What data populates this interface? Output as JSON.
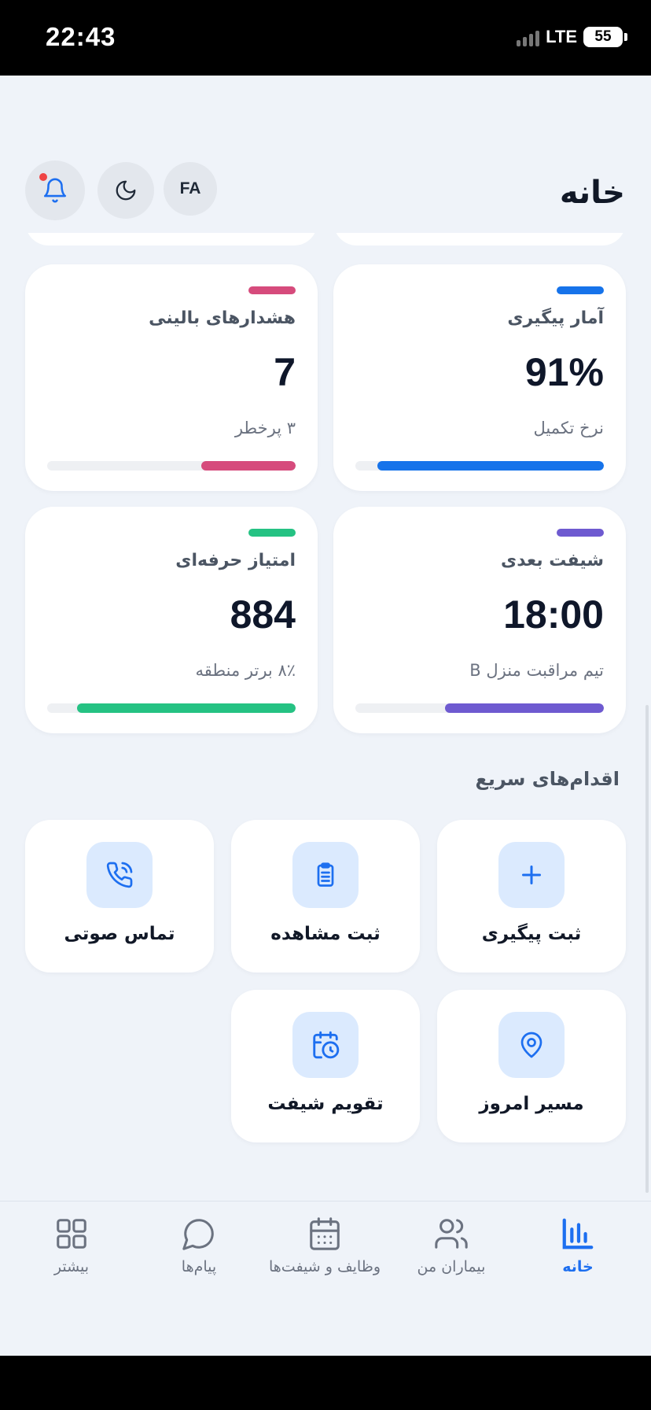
{
  "status_bar": {
    "time": "22:43",
    "network": "LTE",
    "battery": "55"
  },
  "header": {
    "title": "خانه",
    "lang_label": "FA"
  },
  "stats": [
    {
      "title": "آمار پیگیری",
      "value": "91%",
      "subtitle": "نرخ تکمیل",
      "color": "#1673ea",
      "progress": 0.91
    },
    {
      "title": "هشدارهای بالینی",
      "value": "7",
      "subtitle": "۳ پرخطر",
      "color": "#d64b7c",
      "progress": 0.38
    },
    {
      "title": "شیفت بعدی",
      "value": "18:00",
      "subtitle": "تیم مراقبت منزل B",
      "color": "#6e5ad0",
      "progress": 0.64
    },
    {
      "title": "امتیاز حرفه‌ای",
      "value": "884",
      "subtitle": "۸٪ برتر منطقه",
      "color": "#25c283",
      "progress": 0.88
    }
  ],
  "quick_actions_title": "اقدام‌های سریع",
  "quick_actions": [
    {
      "label": "ثبت پیگیری",
      "icon": "plus-icon"
    },
    {
      "label": "ثبت مشاهده",
      "icon": "clipboard-icon"
    },
    {
      "label": "تماس صوتی",
      "icon": "phone-call-icon"
    },
    {
      "label": "مسیر امروز",
      "icon": "map-pin-icon"
    },
    {
      "label": "تقویم شیفت",
      "icon": "calendar-clock-icon"
    }
  ],
  "nav": [
    {
      "label": "خانه",
      "icon": "bar-chart-icon",
      "active": true
    },
    {
      "label": "بیماران من",
      "icon": "users-icon",
      "active": false
    },
    {
      "label": "وظایف و شیفت‌ها",
      "icon": "calendar-icon",
      "active": false
    },
    {
      "label": "پیام‌ها",
      "icon": "chat-bubble-icon",
      "active": false
    },
    {
      "label": "بیشتر",
      "icon": "grid-icon",
      "active": false
    }
  ],
  "colors": {
    "accent": "#1d6ff0",
    "background": "#eff3f9",
    "icon_bg": "#dbeafe"
  }
}
